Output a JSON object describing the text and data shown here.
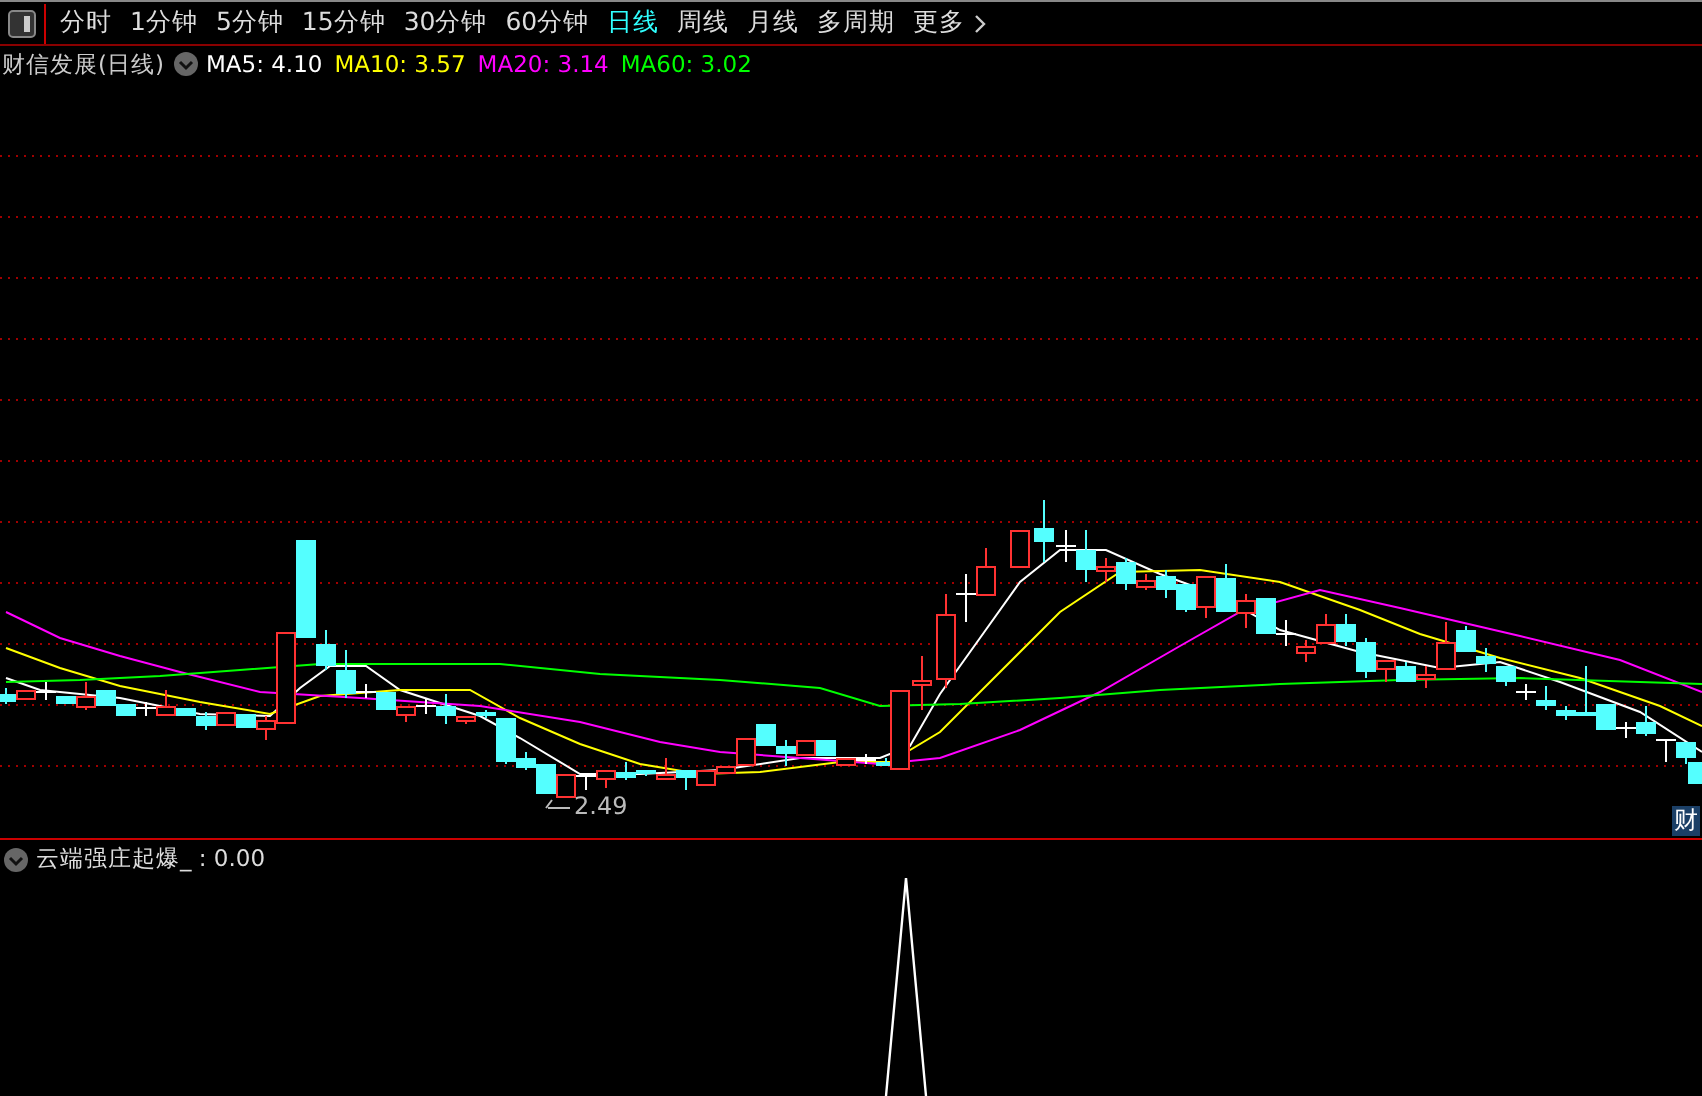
{
  "toolbar": {
    "tabs": [
      {
        "label": "分时",
        "selected": false
      },
      {
        "label": "1分钟",
        "selected": false
      },
      {
        "label": "5分钟",
        "selected": false
      },
      {
        "label": "15分钟",
        "selected": false
      },
      {
        "label": "30分钟",
        "selected": false
      },
      {
        "label": "60分钟",
        "selected": false
      },
      {
        "label": "日线",
        "selected": true
      },
      {
        "label": "周线",
        "selected": false
      },
      {
        "label": "月线",
        "selected": false
      },
      {
        "label": "多周期",
        "selected": false
      },
      {
        "label": "更多",
        "selected": false
      }
    ]
  },
  "main_chart": {
    "title": "财信发展(日线)",
    "indicators": [
      {
        "label": "MA5: 4.10",
        "color": "#ffffff"
      },
      {
        "label": "MA10: 3.57",
        "color": "#ffff00"
      },
      {
        "label": "MA20: 3.14",
        "color": "#ff00ff"
      },
      {
        "label": "MA60: 3.02",
        "color": "#00ff00"
      }
    ],
    "low_marker": "2.49",
    "badge": "财"
  },
  "sub_chart": {
    "title": "云端强庄起爆_ : 0.00"
  }
}
